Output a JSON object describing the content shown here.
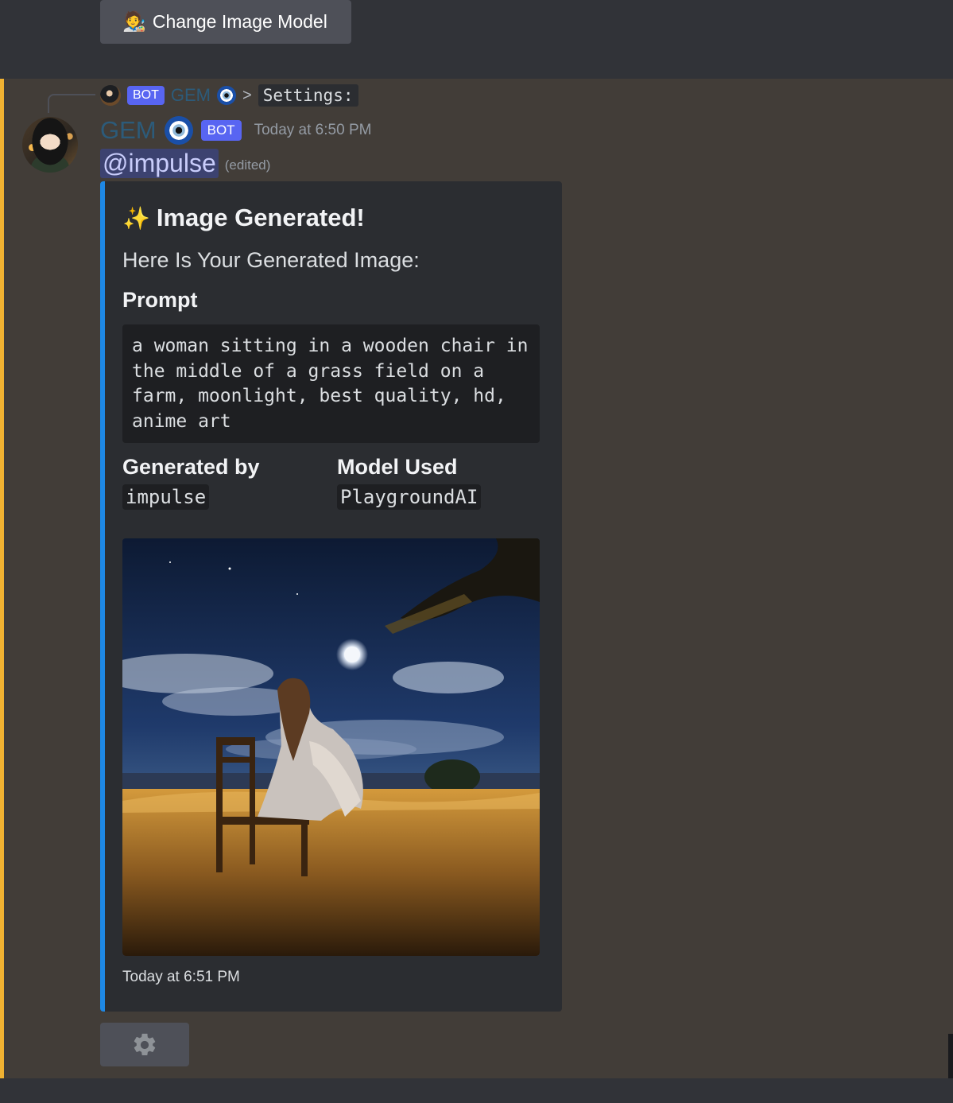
{
  "top_button": {
    "emoji": "🧑‍🎨",
    "label": "Change Image Model"
  },
  "reply": {
    "bot_tag": "BOT",
    "name": "GEM",
    "arrow": ">",
    "code": "Settings:"
  },
  "message": {
    "username": "GEM",
    "bot_tag": "BOT",
    "timestamp": "Today at 6:50 PM",
    "mention": "@impulse",
    "edited": "(edited)"
  },
  "embed": {
    "title_emoji": "✨",
    "title": "Image Generated!",
    "description": "Here Is Your Generated Image:",
    "prompt_label": "Prompt",
    "prompt_text": "a woman sitting in a wooden chair in the middle of a grass field on a farm, moonlight, best quality, hd, anime art",
    "generated_by_label": "Generated by",
    "generated_by_value": "impulse",
    "model_label": "Model Used",
    "model_value": "PlaygroundAI",
    "footer": "Today at 6:51 PM"
  },
  "colors": {
    "accent_bar": "#f0b232",
    "embed_border": "#1e88e5",
    "bot_tag": "#5865f2",
    "mention_bg": "#3c4270"
  },
  "icons": {
    "settings_button": "gear-icon",
    "title": "sparkles-icon",
    "username_badge": "nazar-eye-icon"
  }
}
